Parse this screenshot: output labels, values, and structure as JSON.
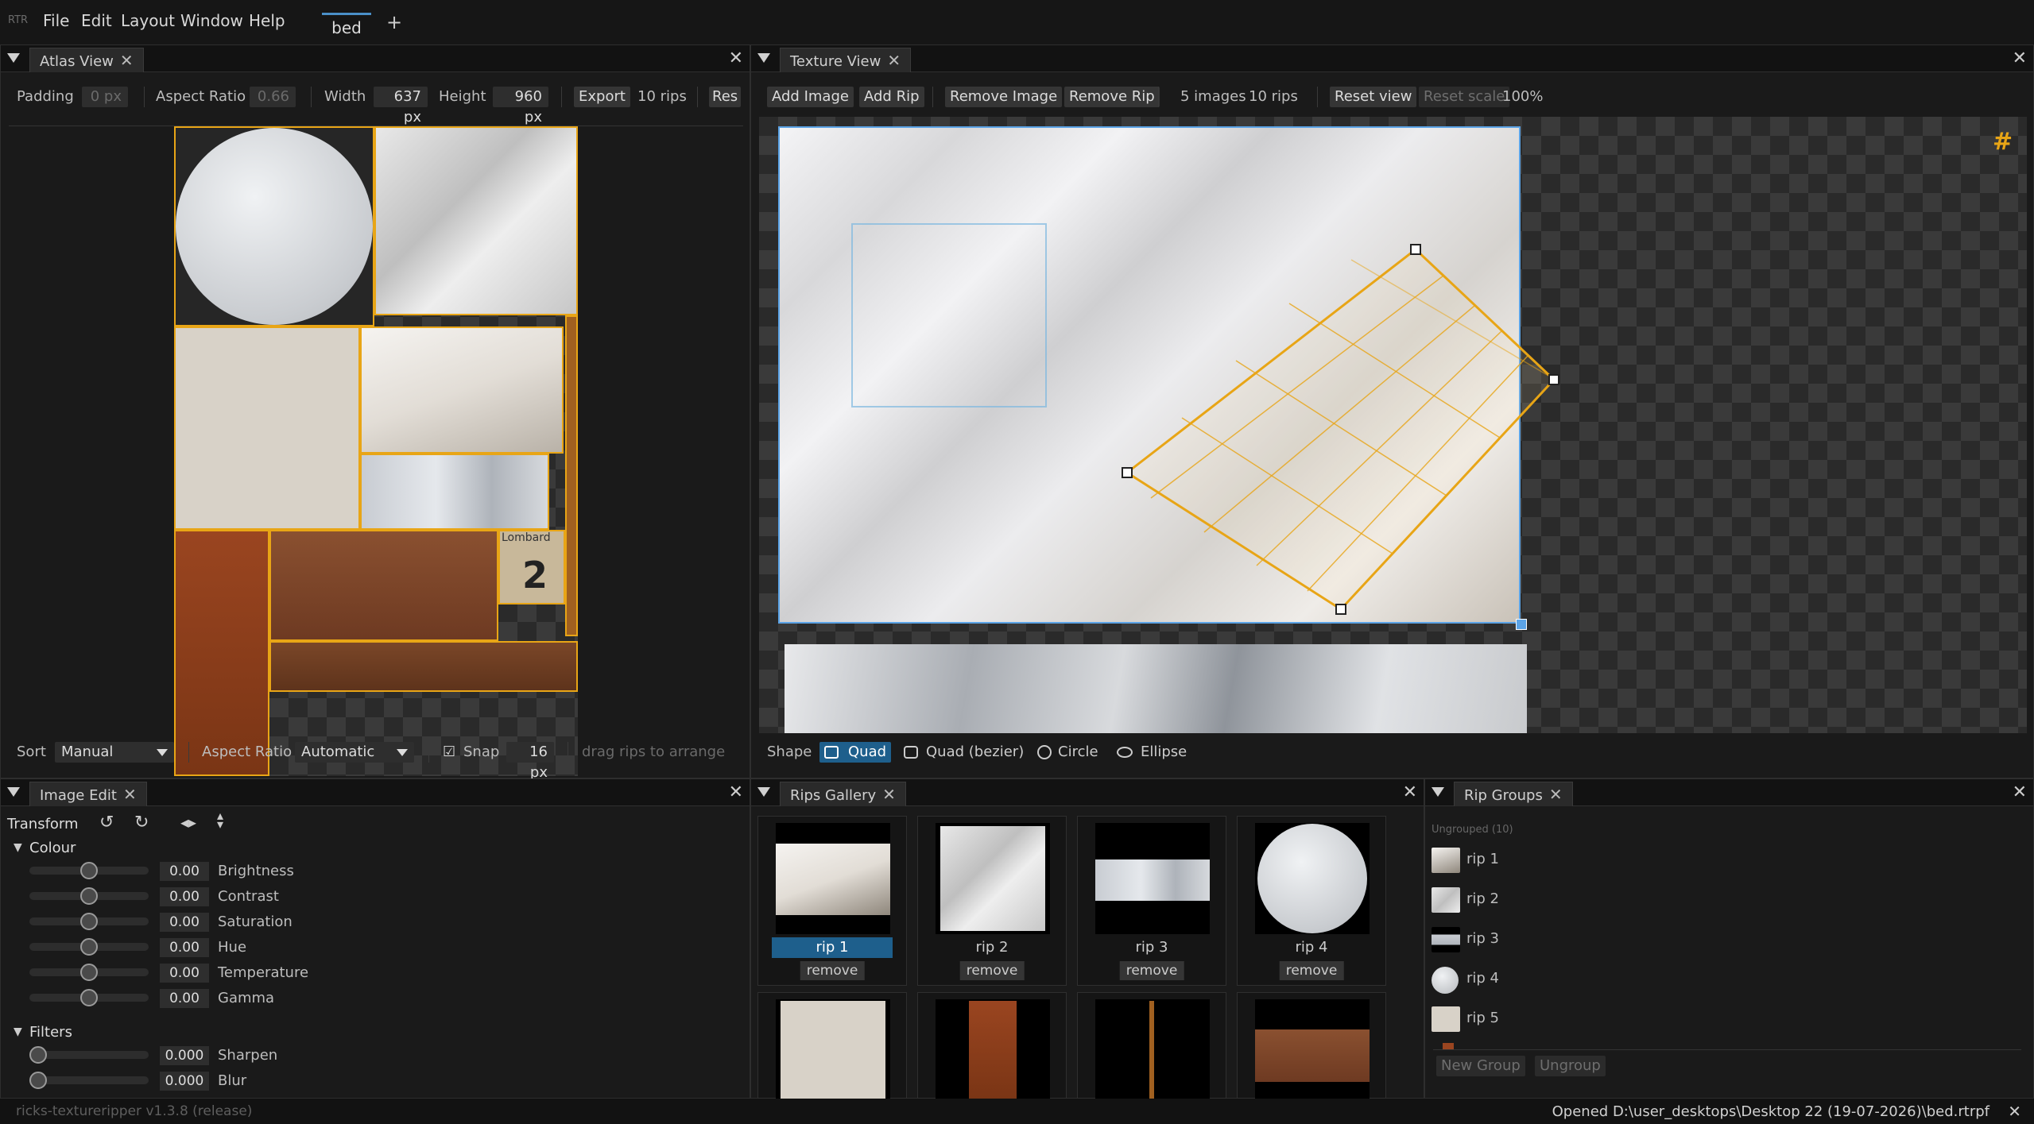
{
  "app": {
    "logo": "RTR",
    "version": "ricks-textureripper v1.3.8 (release)",
    "status": "Opened D:\\user_desktops\\Desktop 22 (19-07-2026)\\bed.rtrpf"
  },
  "menu": [
    "File",
    "Edit",
    "Layout",
    "Window",
    "Help"
  ],
  "document_tab": "bed",
  "atlas": {
    "tab": "Atlas View",
    "padding_label": "Padding",
    "padding_value": "0 px",
    "aspect_label": "Aspect Ratio",
    "aspect_value": "0.66",
    "width_label": "Width",
    "width_value": "637 px",
    "height_label": "Height",
    "height_value": "960 px",
    "export_label": "Export",
    "rips_count": "10 rips",
    "reset_label": "Res",
    "sort_label": "Sort",
    "sort_value": "Manual",
    "aspect2_label": "Aspect Ratio",
    "aspect2_value": "Automatic",
    "snap_label": "Snap",
    "snap_value": "16 px",
    "snap_checked": true,
    "hint": "drag rips to arrange",
    "sign_text": [
      "Lombard",
      "2"
    ]
  },
  "texture": {
    "tab": "Texture View",
    "add_image": "Add Image",
    "add_rip": "Add Rip",
    "remove_image": "Remove Image",
    "remove_rip": "Remove Rip",
    "images_count": "5 images",
    "rips_count": "10 rips",
    "reset_view": "Reset view",
    "reset_scale": "Reset scale",
    "zoom": "100%",
    "shape_label": "Shape",
    "shapes": [
      "Quad",
      "Quad (bezier)",
      "Circle",
      "Ellipse"
    ],
    "selected_shape": "Quad",
    "grid_icon": "hash-icon"
  },
  "image_edit": {
    "tab": "Image Edit",
    "transform_label": "Transform",
    "colour_label": "Colour",
    "colour": [
      {
        "name": "Brightness",
        "value": "0.00",
        "pos": 0.5
      },
      {
        "name": "Contrast",
        "value": "0.00",
        "pos": 0.5
      },
      {
        "name": "Saturation",
        "value": "0.00",
        "pos": 0.5
      },
      {
        "name": "Hue",
        "value": "0.00",
        "pos": 0.5
      },
      {
        "name": "Temperature",
        "value": "0.00",
        "pos": 0.5
      },
      {
        "name": "Gamma",
        "value": "0.00",
        "pos": 0.5
      }
    ],
    "filters_label": "Filters",
    "filters": [
      {
        "name": "Sharpen",
        "value": "0.000",
        "pos": 0
      },
      {
        "name": "Blur",
        "value": "0.000",
        "pos": 0
      }
    ]
  },
  "gallery": {
    "tab": "Rips Gallery",
    "remove_label": "remove",
    "cards": [
      {
        "name": "rip 1",
        "selected": true
      },
      {
        "name": "rip 2",
        "selected": false
      },
      {
        "name": "rip 3",
        "selected": false
      },
      {
        "name": "rip 4",
        "selected": false
      }
    ]
  },
  "groups": {
    "tab": "Rip Groups",
    "ungrouped": "Ungrouped (10)",
    "items": [
      "rip 1",
      "rip 2",
      "rip 3",
      "rip 4",
      "rip 5"
    ],
    "new_group": "New Group",
    "ungroup": "Ungroup"
  },
  "colors": {
    "accent": "#e8a516",
    "selection": "#1e5f8c",
    "view_border": "#5ba3e6"
  }
}
